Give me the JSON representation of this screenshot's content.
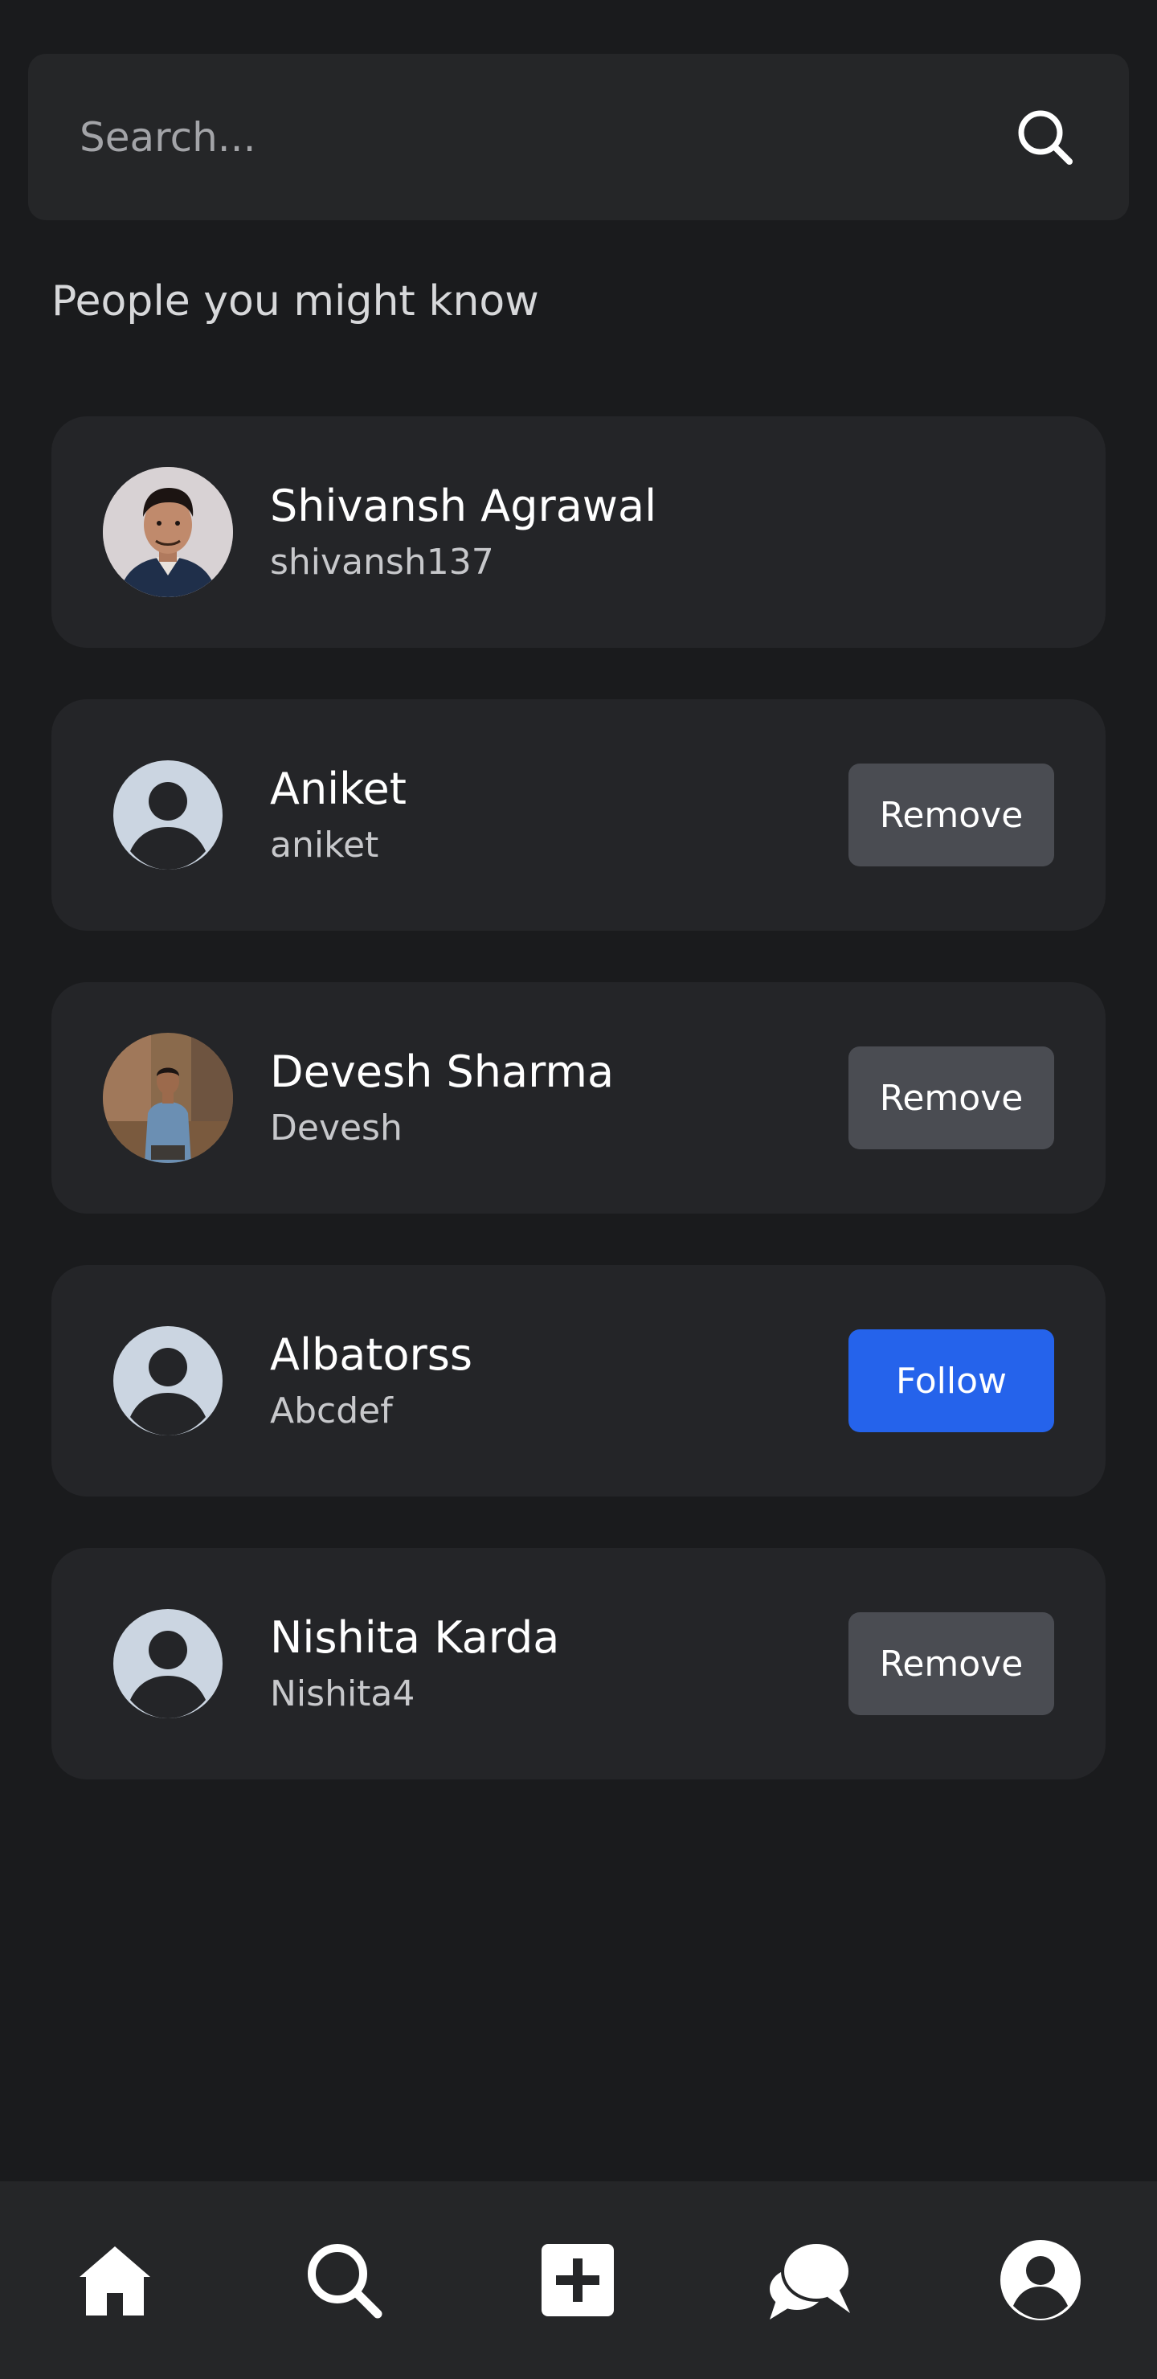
{
  "search": {
    "placeholder": "Search..."
  },
  "section": {
    "title": "People you might know"
  },
  "people": [
    {
      "name": "Shivansh Agrawal",
      "handle": "shivansh137",
      "avatar": "photo",
      "action": ""
    },
    {
      "name": "Aniket",
      "handle": "aniket",
      "avatar": "default-user-icon",
      "action": "Remove"
    },
    {
      "name": "Devesh Sharma",
      "handle": "Devesh",
      "avatar": "photo",
      "action": "Remove"
    },
    {
      "name": "Albatorss",
      "handle": "Abcdef",
      "avatar": "default-user-icon",
      "action": "Follow"
    },
    {
      "name": "Nishita Karda",
      "handle": "Nishita4",
      "avatar": "default-user-icon",
      "action": "Remove"
    }
  ],
  "nav": {
    "items": [
      "home-icon",
      "search-icon",
      "create-post-icon",
      "messages-icon",
      "profile-icon"
    ]
  },
  "colors": {
    "background": "#1a1b1d",
    "card": "#242528",
    "remove_button": "#4a4c52",
    "follow_button": "#2563eb",
    "avatar_placeholder": "#cbd5e1"
  }
}
